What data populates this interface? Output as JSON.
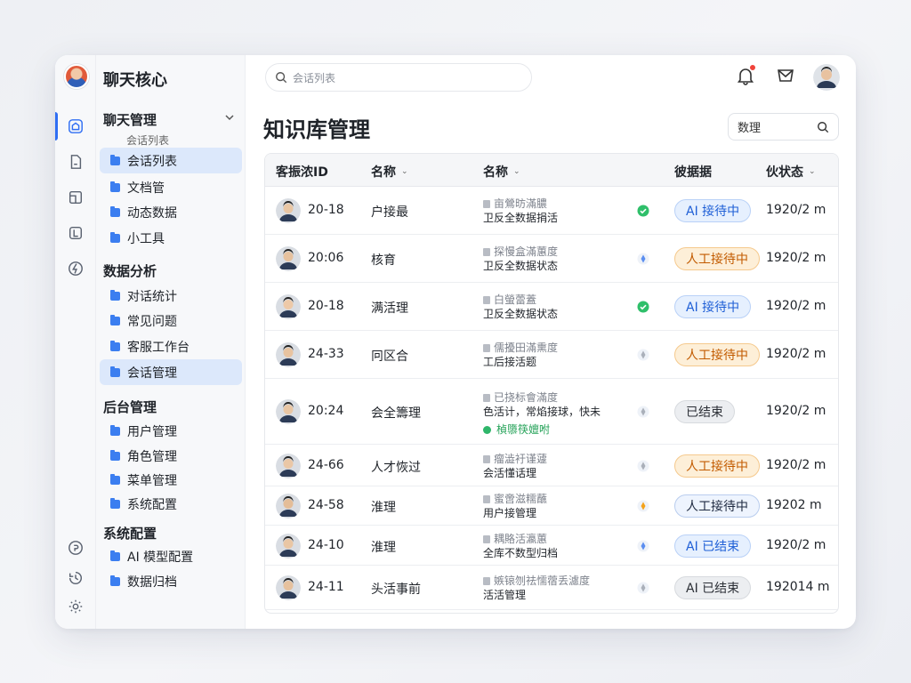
{
  "app": {
    "title": "聊天核心"
  },
  "search": {
    "placeholder": "会话列表"
  },
  "page": {
    "title": "知识库管理"
  },
  "filter": {
    "label": "数理"
  },
  "nav": {
    "groups": [
      {
        "label": "聊天管理",
        "sub": "会话列表",
        "items": [
          "会话列表",
          "文档管",
          "动态数据",
          "小工具"
        ]
      },
      {
        "label": "数据分析",
        "items": [
          "对话统计",
          "常见问题",
          "客服工作台",
          "会话管理"
        ]
      },
      {
        "label": "后台管理",
        "items": [
          "用户管理",
          "角色管理",
          "菜单管理",
          "系统配置"
        ]
      },
      {
        "label": "系统配置",
        "items": [
          "AI 模型配置",
          "数据归档"
        ]
      }
    ]
  },
  "table": {
    "headers": [
      "客振浓ID",
      "名称",
      "名称",
      "彼据据",
      "伙状态"
    ],
    "rows": [
      {
        "id": "20-18",
        "name": "户接最",
        "d1": "亩鶯昉滿膿",
        "d2": "卫反全数据捐活",
        "indicator": "check",
        "status": "AI 接待中",
        "type": "ai",
        "date": "1920/2 m"
      },
      {
        "id": "20:06",
        "name": "核育",
        "d1": "探慢盒滿蕙度",
        "d2": "卫反全数据状态",
        "indicator": "diamond",
        "status": "人工接待中",
        "type": "human",
        "date": "1920/2 m"
      },
      {
        "id": "20-18",
        "name": "满活理",
        "d1": "白螢蕾蓋",
        "d2": "卫反全数据状态",
        "indicator": "check",
        "status": "AI 接待中",
        "type": "ai",
        "date": "1920/2 m"
      },
      {
        "id": "24-33",
        "name": "冋区合",
        "d1": "儒擾田滿熏度",
        "d2": "工后接活题",
        "indicator": "diamond-grey",
        "status": "人工接待中",
        "type": "human",
        "date": "1920/2 m"
      },
      {
        "id": "20:24",
        "name": "会全籌理",
        "d1": "已挠标會滿度",
        "d2": "色活计，常焰接球，快未",
        "d3": "楨隳筷嬗咐",
        "indicator": "diamond-grey",
        "status": "已结束",
        "type": "ended",
        "date": "1920/2 m"
      },
      {
        "id": "24-66",
        "name": "人才恢过",
        "d1": "瘤澁衧谨蘧",
        "d2": "会活懂话理",
        "indicator": "diamond-grey",
        "status": "人工接待中",
        "type": "human",
        "date": "1920/2 m"
      },
      {
        "id": "24-58",
        "name": "淮理",
        "d1": "蜜啻滋糯蘸",
        "d2": "用户接管理",
        "indicator": "diamond-gold",
        "status": "人工接待中",
        "type": "human-blue",
        "date": "19202 m"
      },
      {
        "id": "24-10",
        "name": "淮理",
        "d1": "耦賂活瀛蕙",
        "d2": "全库不数型归档",
        "indicator": "diamond",
        "status": "AI 已结束",
        "type": "ai",
        "date": "1920/2 m"
      },
      {
        "id": "24-11",
        "name": "头活事前",
        "d1": "嫉锿刎祛懦蓿丢濾度",
        "d2": "活活管理",
        "indicator": "diamond-grey",
        "status": "AI 已结束",
        "type": "ended",
        "date": "192014 m"
      }
    ]
  }
}
